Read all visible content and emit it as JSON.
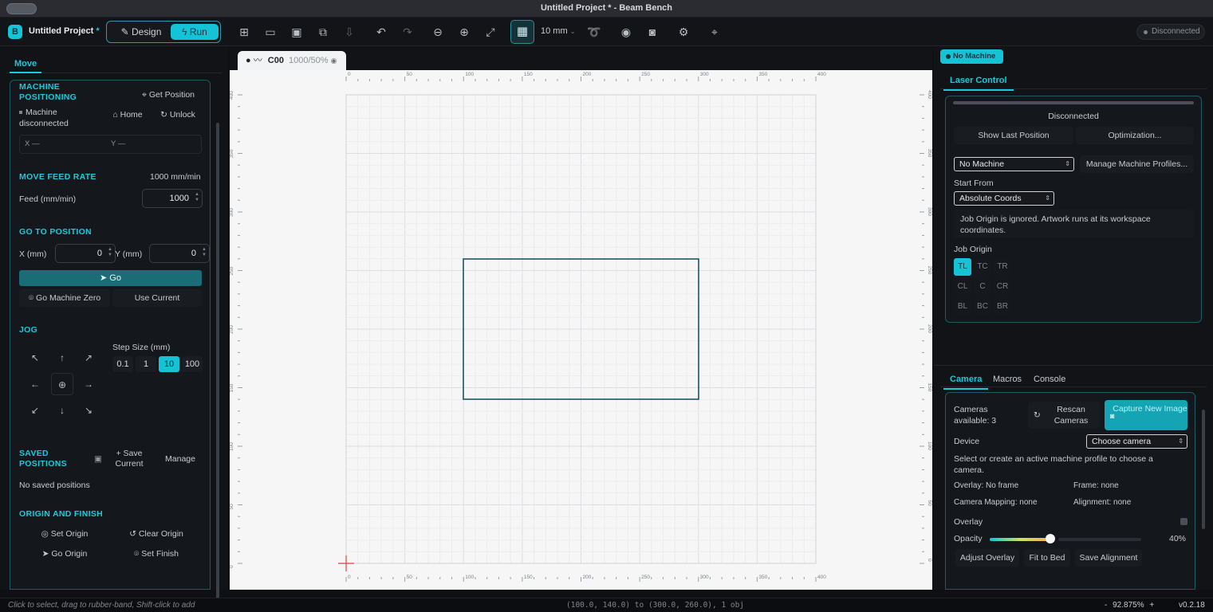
{
  "window": {
    "title": "Untitled Project * - Beam Bench"
  },
  "toolbar": {
    "project_name": "Untitled Project",
    "modified_marker": "*",
    "design_label": "Design",
    "run_label": "Run",
    "grid_size": "10 mm",
    "connection_status": "Disconnected",
    "icons": [
      "new-file-icon",
      "open-folder-icon",
      "save-icon",
      "save-as-icon",
      "import-icon",
      "undo-icon",
      "redo-icon",
      "zoom-out-icon",
      "zoom-in-icon",
      "fit-view-icon",
      "grid-icon",
      "trace-icon",
      "preview-eye-icon",
      "camera-icon",
      "settings-gear-icon",
      "location-pin-icon"
    ]
  },
  "left": {
    "tab": "Move",
    "positioning": {
      "heading": "MACHINE POSITIONING",
      "get_position": "Get Position",
      "status": "Machine disconnected",
      "home": "Home",
      "unlock": "Unlock",
      "x_label": "X",
      "x_value": "—",
      "y_label": "Y",
      "y_value": "—"
    },
    "feed": {
      "heading": "MOVE FEED RATE",
      "rate_display": "1000 mm/min",
      "label": "Feed (mm/min)",
      "value": "1000"
    },
    "goto": {
      "heading": "GO TO POSITION",
      "x_label": "X (mm)",
      "x_value": "0",
      "y_label": "Y (mm)",
      "y_value": "0",
      "go": "Go",
      "go_zero": "Go Machine Zero",
      "use_current": "Use Current"
    },
    "jog": {
      "heading": "JOG",
      "step_label": "Step Size (mm)",
      "steps": [
        "0.1",
        "1",
        "10",
        "100"
      ],
      "selected_step": "10"
    },
    "saved": {
      "heading": "SAVED POSITIONS",
      "save_current": "+ Save Current",
      "manage": "Manage",
      "empty": "No saved positions"
    },
    "origin": {
      "heading": "ORIGIN AND FINISH",
      "set_origin": "Set Origin",
      "clear_origin": "Clear Origin",
      "go_origin": "Go Origin",
      "set_finish": "Set Finish"
    }
  },
  "canvas": {
    "layer_tab": {
      "name": "C00",
      "settings": "1000/50%"
    },
    "ruler_labels": [
      "0",
      "50",
      "100",
      "150",
      "200",
      "250",
      "300",
      "350",
      "400"
    ],
    "vruler_labels": [
      "400",
      "350",
      "300",
      "250",
      "200",
      "150",
      "100",
      "50",
      "0"
    ]
  },
  "right": {
    "machine_pill": "No Machine",
    "tab": "Laser Control",
    "laser": {
      "status": "Disconnected",
      "show_last": "Show Last Position",
      "optimization": "Optimization...",
      "machine_select": "No Machine",
      "manage_profiles": "Manage Machine Profiles...",
      "start_from_label": "Start From",
      "start_from": "Absolute Coords",
      "note": "Job Origin is ignored. Artwork runs at its workspace coordinates.",
      "job_origin_label": "Job Origin",
      "origins": [
        "TL",
        "TC",
        "TR",
        "CL",
        "C",
        "CR",
        "BL",
        "BC",
        "BR"
      ],
      "selected_origin": "TL"
    },
    "bottom_tabs": [
      "Camera",
      "Macros",
      "Console"
    ],
    "camera": {
      "available": "Cameras available: 3",
      "rescan": "Rescan Cameras",
      "capture": "Capture New Image",
      "device_label": "Device",
      "device_select": "Choose camera",
      "hint": "Select or create an active machine profile to choose a camera.",
      "overlay_status": "Overlay: No frame",
      "frame_status": "Frame: none",
      "mapping_status": "Camera Mapping: none",
      "alignment_status": "Alignment: none",
      "overlay_label": "Overlay",
      "opacity_label": "Opacity",
      "opacity_value": "40%",
      "opacity_fraction": 0.4,
      "adjust_overlay": "Adjust Overlay",
      "fit_to_bed": "Fit to Bed",
      "save_alignment": "Save Alignment"
    }
  },
  "status": {
    "hint": "Click to select, drag to rubber-band, Shift-click to add",
    "selection": "(100.0, 140.0) to (300.0, 260.0), 1 obj",
    "zoom_minus": "-",
    "zoom": "92.875%",
    "zoom_plus": "+",
    "version": "v0.2.18"
  }
}
